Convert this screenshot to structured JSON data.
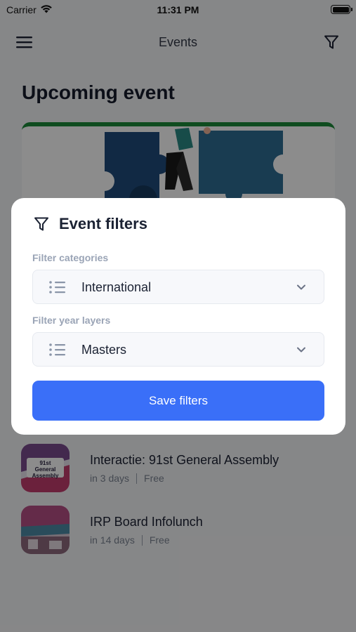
{
  "status_bar": {
    "carrier": "Carrier",
    "time": "11:31 PM",
    "wifi_icon": "wifi-icon",
    "battery_icon": "battery-icon"
  },
  "nav": {
    "title": "Events",
    "menu_icon": "hamburger-menu-icon",
    "filter_icon": "funnel-filter-icon"
  },
  "upcoming": {
    "title": "Upcoming event",
    "image": "puzzle-illustration"
  },
  "events": [
    {
      "name": "Interactie: 91st General Assembly",
      "when": "in 3 days",
      "price": "Free",
      "thumb_text": "91st General Assembly"
    },
    {
      "name": "IRP Board Infolunch",
      "when": "in 14 days",
      "price": "Free"
    }
  ],
  "modal": {
    "title": "Event filters",
    "icon": "funnel-filter-icon",
    "categories": {
      "label": "Filter categories",
      "value": "International",
      "icon": "list-icon"
    },
    "year_layers": {
      "label": "Filter year layers",
      "value": "Masters",
      "icon": "list-icon"
    },
    "save_label": "Save filters"
  },
  "colors": {
    "accent": "#3a6ff8",
    "card_top": "#1d8a3a",
    "label": "#9aa4b6",
    "overlay": "rgba(0,0,0,0.45)"
  }
}
